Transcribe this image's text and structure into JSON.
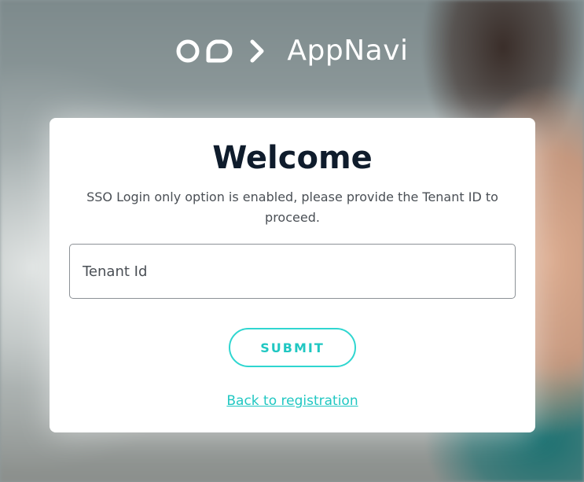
{
  "header": {
    "brand_name": "AppNavi",
    "logo_color": "#ffffff"
  },
  "card": {
    "title": "Welcome",
    "subtitle": "SSO Login only option is enabled, please provide the Tenant ID to proceed.",
    "tenant_field": {
      "placeholder": "Tenant Id",
      "value": ""
    },
    "submit_label": "SUBMIT",
    "back_link_label": "Back to registration"
  },
  "colors": {
    "accent": "#20c7c2",
    "title": "#0f1c2c",
    "text": "#4a4f55"
  }
}
